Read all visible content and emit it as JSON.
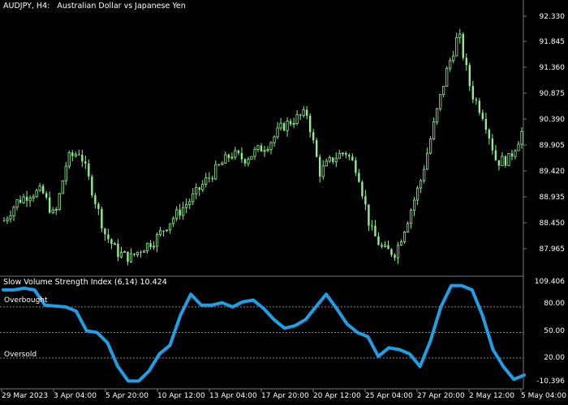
{
  "header": {
    "symbol": "AUDJPY, H4:",
    "description": "Australian Dollar vs Japanese Yen"
  },
  "price_axis": [
    "92.330",
    "91.845",
    "91.360",
    "90.875",
    "90.390",
    "89.905",
    "89.420",
    "88.935",
    "88.450",
    "87.965"
  ],
  "indicator": {
    "title": "Slow Volume Strength Index (6,14) 10.424",
    "axis": [
      "109.406",
      "80.00",
      "50.00",
      "20.00",
      "-10.396"
    ],
    "overbought_label": "Overbought",
    "oversold_label": "Oversold",
    "line_color": "#1E9FE6",
    "candle_color": "#90EE90"
  },
  "time_axis": [
    "29 Mar 2023",
    "3 Apr 04:00",
    "5 Apr 20:00",
    "10 Apr 12:00",
    "13 Apr 04:00",
    "17 Apr 20:00",
    "20 Apr 12:00",
    "25 Apr 04:00",
    "27 Apr 20:00",
    "2 May 12:00",
    "5 May 04:00"
  ],
  "chart_data": [
    {
      "type": "candlestick",
      "title": "AUDJPY, H4: Australian Dollar vs Japanese Yen",
      "ylim": [
        87.8,
        92.4
      ],
      "x": [
        "29 Mar 2023",
        "3 Apr 04:00",
        "5 Apr 20:00",
        "10 Apr 12:00",
        "13 Apr 04:00",
        "17 Apr 20:00",
        "20 Apr 12:00",
        "25 Apr 04:00",
        "27 Apr 20:00",
        "2 May 12:00",
        "5 May 04:00"
      ],
      "close_path": [
        88.55,
        88.9,
        89.05,
        89.1,
        88.6,
        89.7,
        89.85,
        89.1,
        88.3,
        87.95,
        87.85,
        88.05,
        88.2,
        88.5,
        88.75,
        89.0,
        89.3,
        89.55,
        89.8,
        89.7,
        89.85,
        90.0,
        90.3,
        90.45,
        90.55,
        89.45,
        89.7,
        89.85,
        89.5,
        88.4,
        88.0,
        87.95,
        88.6,
        89.3,
        90.3,
        91.3,
        92.05,
        90.95,
        90.5,
        89.65,
        89.7,
        90.2
      ]
    },
    {
      "type": "line",
      "title": "Slow Volume Strength Index (6,14) 10.424",
      "ylim": [
        -10.396,
        109.406
      ],
      "levels": [
        80,
        50,
        20
      ],
      "values": [
        100,
        100,
        102,
        100,
        82,
        81,
        80,
        75,
        52,
        50,
        38,
        10,
        -7,
        -7,
        5,
        25,
        35,
        70,
        95,
        82,
        82,
        85,
        80,
        86,
        88,
        78,
        65,
        55,
        58,
        65,
        80,
        95,
        78,
        60,
        50,
        45,
        22,
        32,
        30,
        25,
        10,
        40,
        80,
        105,
        105,
        100,
        70,
        30,
        10,
        -5,
        0
      ]
    }
  ]
}
